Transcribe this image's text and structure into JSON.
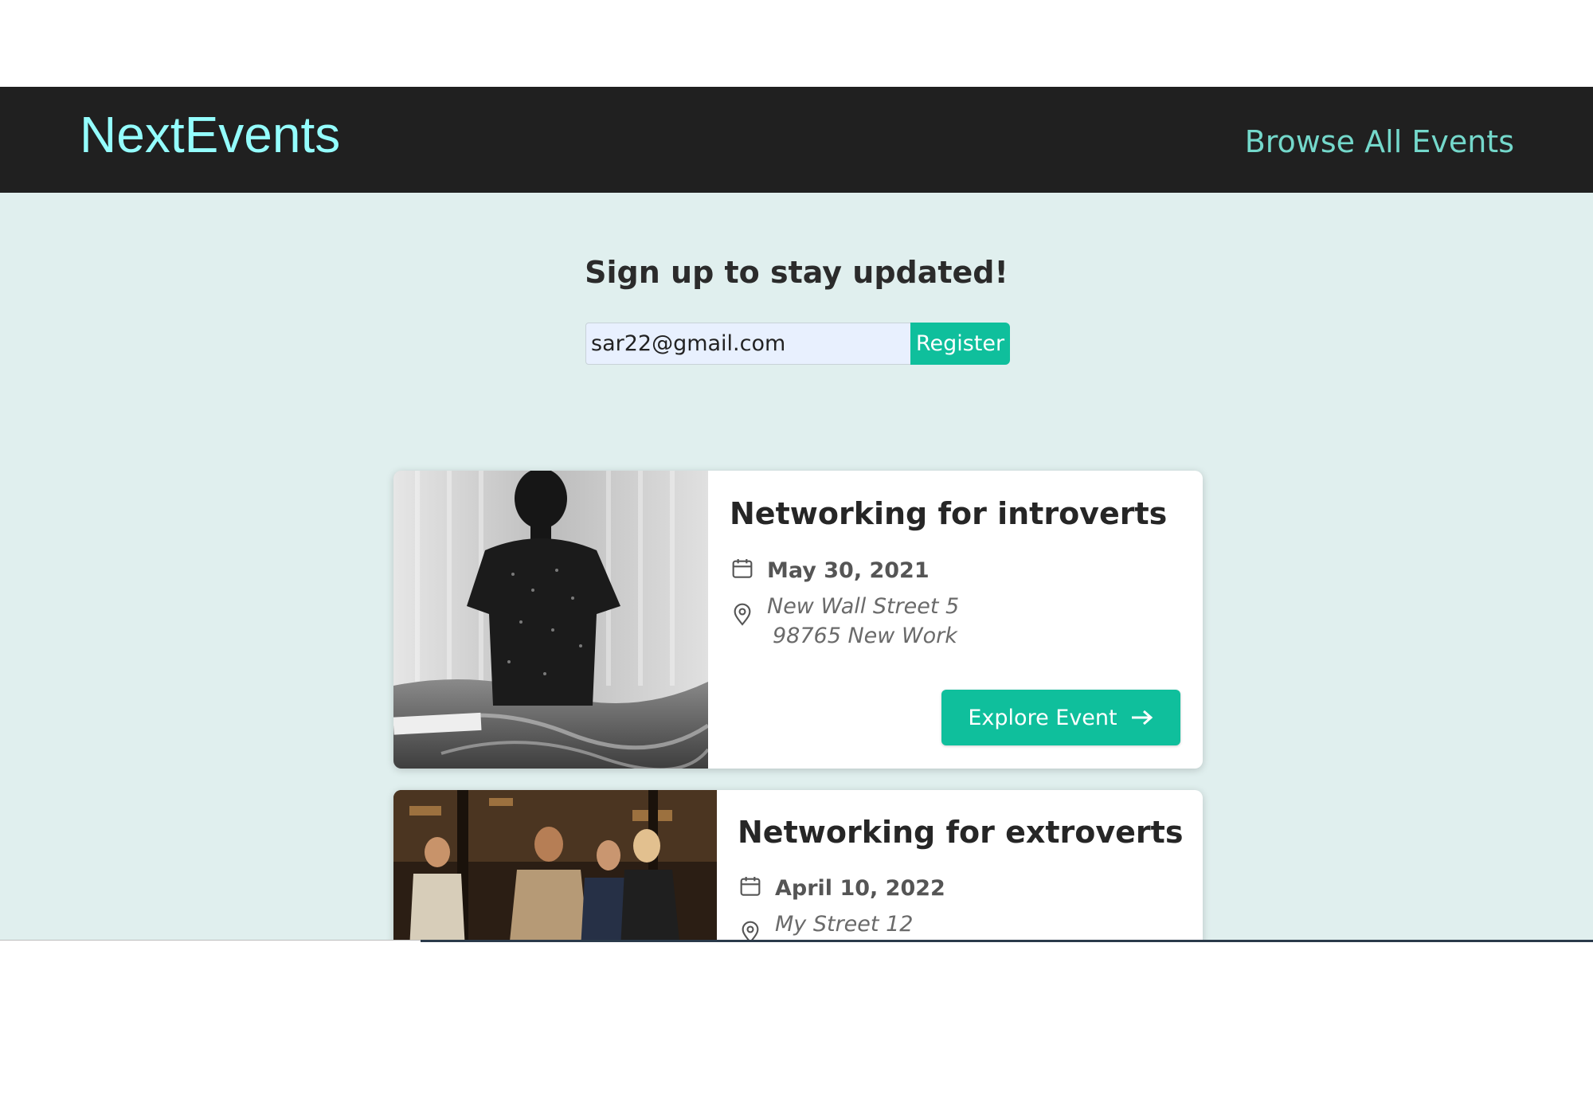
{
  "header": {
    "logo": "NextEvents",
    "nav_link": "Browse All Events"
  },
  "signup": {
    "title": "Sign up to stay updated!",
    "email_value": "sar22@gmail.com",
    "register_label": "Register"
  },
  "events": [
    {
      "title": "Networking for introverts",
      "date": "May 30, 2021",
      "address_line1": "New Wall Street 5",
      "address_line2": "98765 New Work",
      "button_label": "Explore Event"
    },
    {
      "title": "Networking for extroverts",
      "date": "April 10, 2022",
      "address_line1": "My Street 12"
    }
  ],
  "colors": {
    "header_bg": "#202020",
    "logo": "#94fdfd",
    "accent": "#0fbf9c",
    "page_bg": "#e0efee"
  },
  "icons": {
    "date": "calendar-icon",
    "location": "map-pin-icon",
    "arrow": "arrow-right-icon"
  }
}
